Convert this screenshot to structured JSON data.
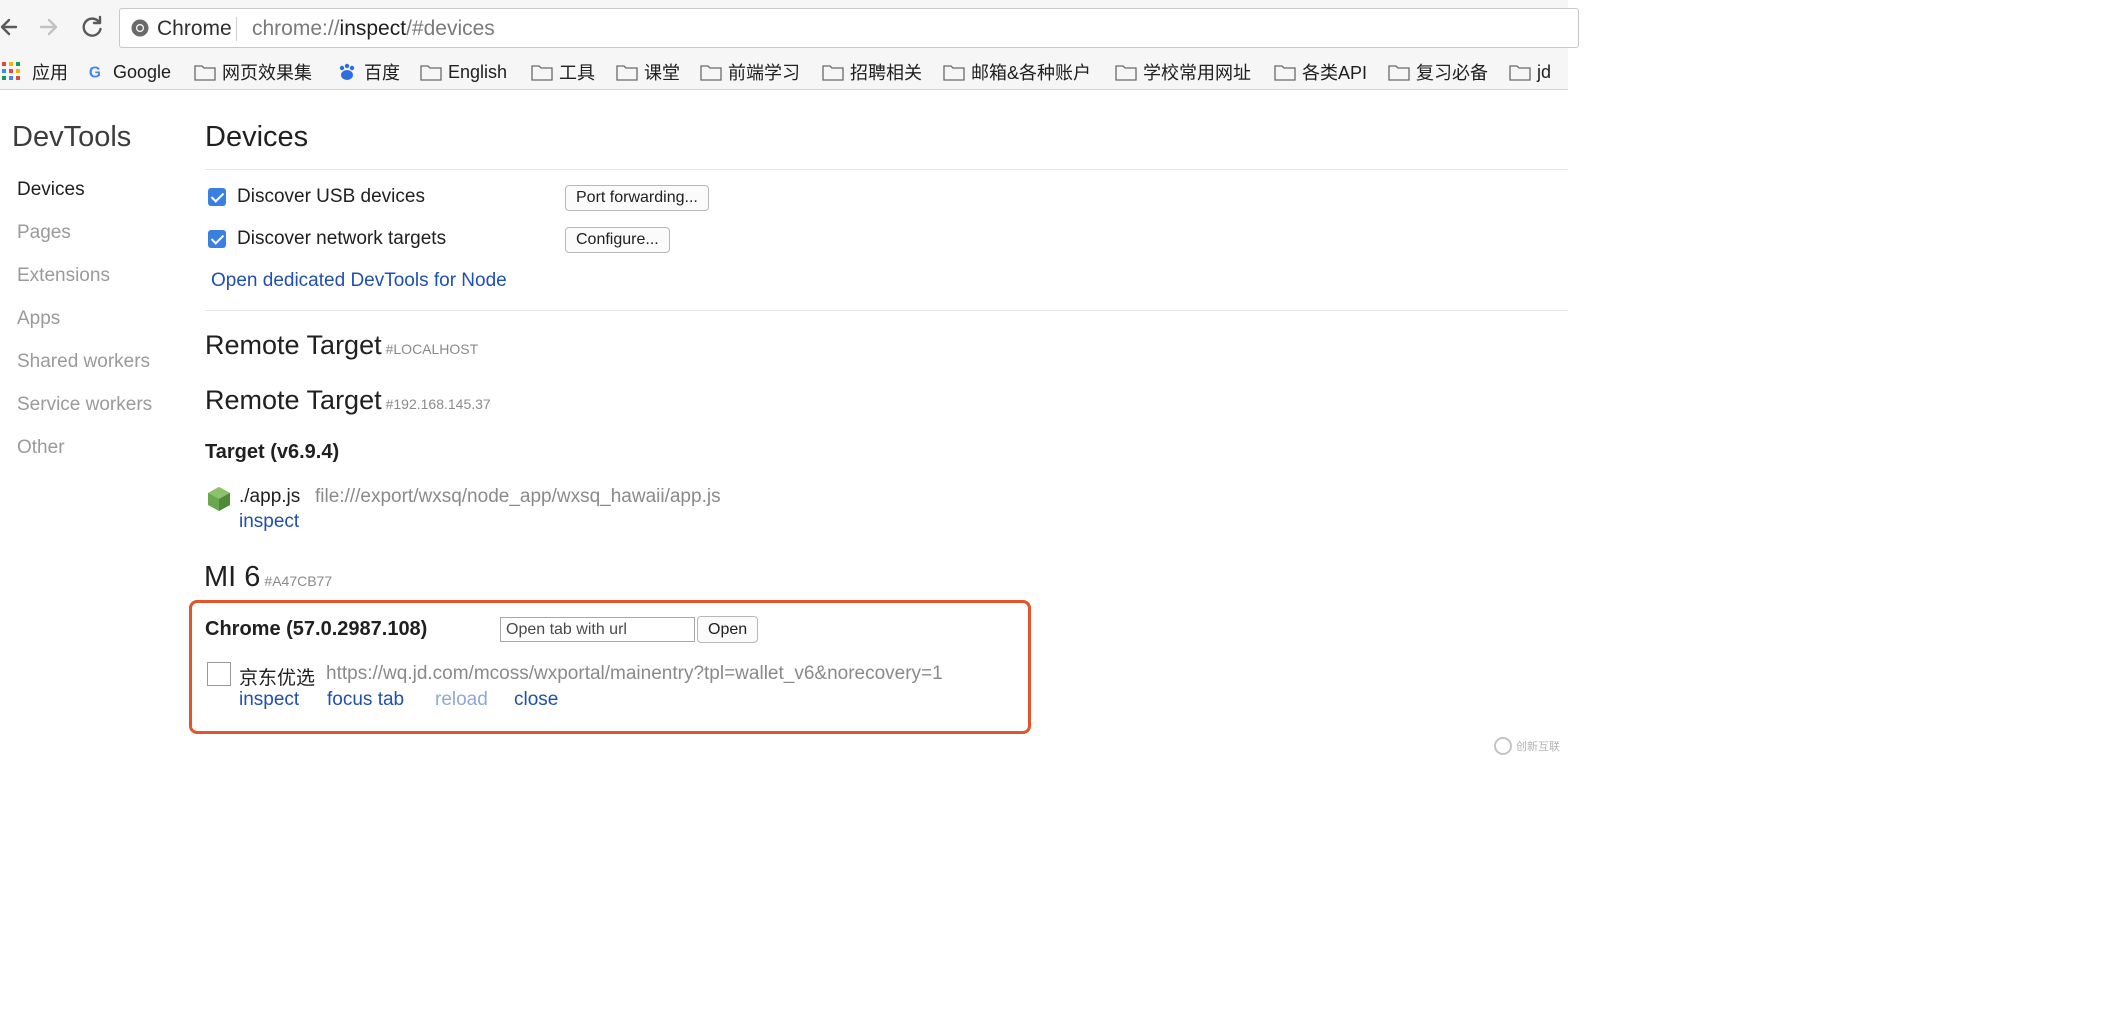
{
  "browser": {
    "site_chip": "Chrome",
    "url_prefix": "chrome://",
    "url_host": "inspect",
    "url_hash": "/#devices"
  },
  "bookmarks": [
    {
      "label": "应用",
      "icon": "apps-grid-icon"
    },
    {
      "label": "Google",
      "icon": "google-icon"
    },
    {
      "label": "网页效果集",
      "icon": "folder-icon"
    },
    {
      "label": "百度",
      "icon": "baidu-icon"
    },
    {
      "label": "English",
      "icon": "folder-icon"
    },
    {
      "label": "工具",
      "icon": "folder-icon"
    },
    {
      "label": "课堂",
      "icon": "folder-icon"
    },
    {
      "label": "前端学习",
      "icon": "folder-icon"
    },
    {
      "label": "招聘相关",
      "icon": "folder-icon"
    },
    {
      "label": "邮箱&各种账户",
      "icon": "folder-icon"
    },
    {
      "label": "学校常用网址",
      "icon": "folder-icon"
    },
    {
      "label": "各类API",
      "icon": "folder-icon"
    },
    {
      "label": "复习必备",
      "icon": "folder-icon"
    },
    {
      "label": "jd",
      "icon": "folder-icon"
    }
  ],
  "sidebar": {
    "title": "DevTools",
    "items": [
      "Devices",
      "Pages",
      "Extensions",
      "Apps",
      "Shared workers",
      "Service workers",
      "Other"
    ],
    "active": "Devices"
  },
  "main": {
    "title": "Devices",
    "discover_usb": {
      "label": "Discover USB devices",
      "checked": true,
      "button": "Port forwarding..."
    },
    "discover_network": {
      "label": "Discover network targets",
      "checked": true,
      "button": "Configure..."
    },
    "node_link": "Open dedicated DevTools for Node",
    "remote_targets": [
      {
        "title": "Remote Target",
        "tag": "#LOCALHOST"
      },
      {
        "title": "Remote Target",
        "tag": "#192.168.145.37"
      }
    ],
    "target": {
      "title": "Target (v6.9.4)",
      "app_name": "./app.js",
      "app_url": "file:///export/wxsq/node_app/wxsq_hawaii/app.js",
      "inspect": "inspect"
    },
    "device": {
      "name": "MI 6",
      "tag": "#A47CB77",
      "browser": "Chrome (57.0.2987.108)",
      "open_tab_placeholder": "Open tab with url",
      "open_button": "Open",
      "page": {
        "name": "京东优选",
        "url": "https://wq.jd.com/mcoss/wxportal/mainentry?tpl=wallet_v6&norecovery=1",
        "checked": false,
        "actions": {
          "inspect": "inspect",
          "focus": "focus tab",
          "reload": "reload",
          "close": "close"
        }
      }
    }
  },
  "colors": {
    "accent": "#3a80e0",
    "link": "#1f4fb3",
    "highlight": "#e2542b"
  },
  "watermark": "创新互联"
}
